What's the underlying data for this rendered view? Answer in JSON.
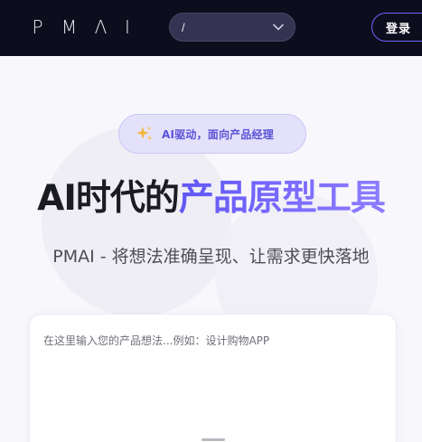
{
  "nav": {
    "logo_letters": [
      "P",
      "M",
      "Λ",
      "I"
    ],
    "selector_value": "/",
    "login_label": "登录"
  },
  "hero": {
    "badge_icon": "sparkles-icon",
    "badge_text": "AI驱动，面向产品经理",
    "headline_dark": "AI时代的",
    "headline_highlight": "产品原型工具",
    "subtitle": "PMAI - 将想法准确呈现、让需求更快落地"
  },
  "prompt": {
    "placeholder": "在这里输入您的产品想法...例如：设计购物APP",
    "value": ""
  },
  "colors": {
    "nav_bg": "#0d0d1d",
    "accent": "#6157f5",
    "badge_bg": "#e4e2fb",
    "badge_text": "#5b53d6"
  }
}
